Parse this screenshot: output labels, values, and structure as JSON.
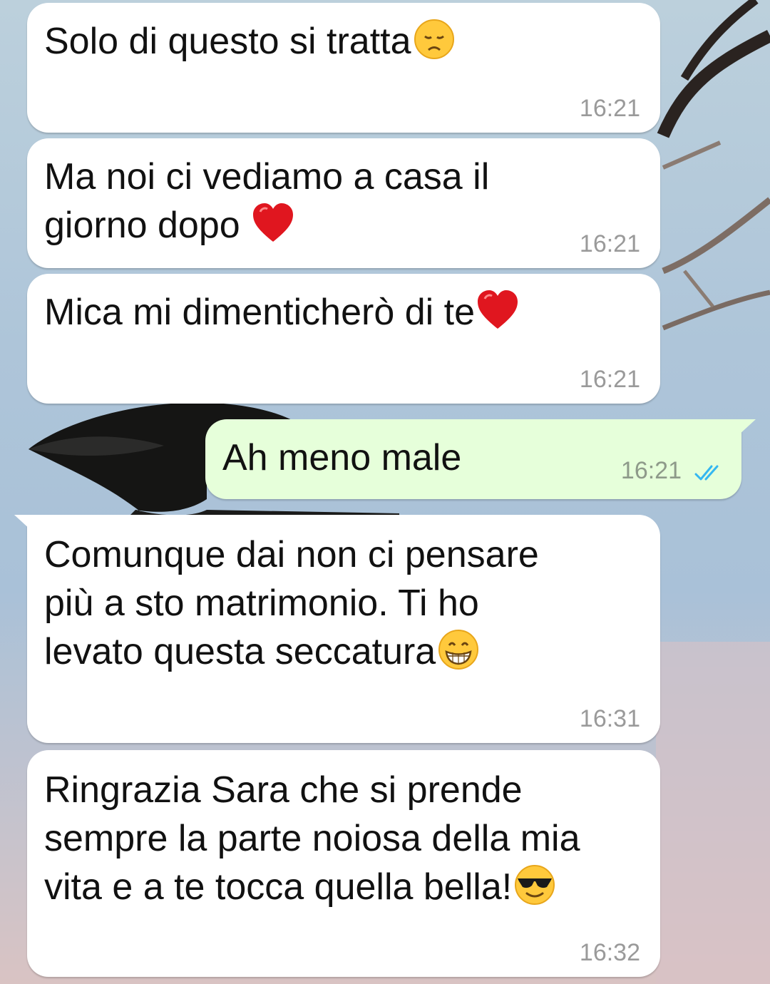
{
  "messages": [
    {
      "direction": "incoming",
      "text": "Solo di questo si tratta",
      "emoji": "disappointed-face",
      "time": "16:21"
    },
    {
      "direction": "incoming",
      "text": "Ma noi ci vediamo a casa il\ngiorno dopo ",
      "emoji": "red-heart",
      "time": "16:21"
    },
    {
      "direction": "incoming",
      "text": "Mica mi dimenticherò di te",
      "emoji": "red-heart",
      "time": "16:21"
    },
    {
      "direction": "outgoing",
      "text": "Ah meno male",
      "time": "16:21",
      "status": "read"
    },
    {
      "direction": "incoming",
      "text": "Comunque dai non ci pensare\npiù a sto matrimonio. Ti ho\nlevato questa seccatura",
      "emoji": "grinning-face",
      "time": "16:31"
    },
    {
      "direction": "incoming",
      "text": "Ringrazia Sara che si prende\nsempre la parte noiosa della mia\nvita e a te tocca quella bella!",
      "emoji": "sunglasses-face",
      "time": "16:32"
    }
  ],
  "colors": {
    "incoming_bubble": "#ffffff",
    "outgoing_bubble": "#e6ffda",
    "read_ticks": "#34b7f1",
    "time_text": "#9a9a9a"
  },
  "wallpaper": "crow-on-branch-sky"
}
